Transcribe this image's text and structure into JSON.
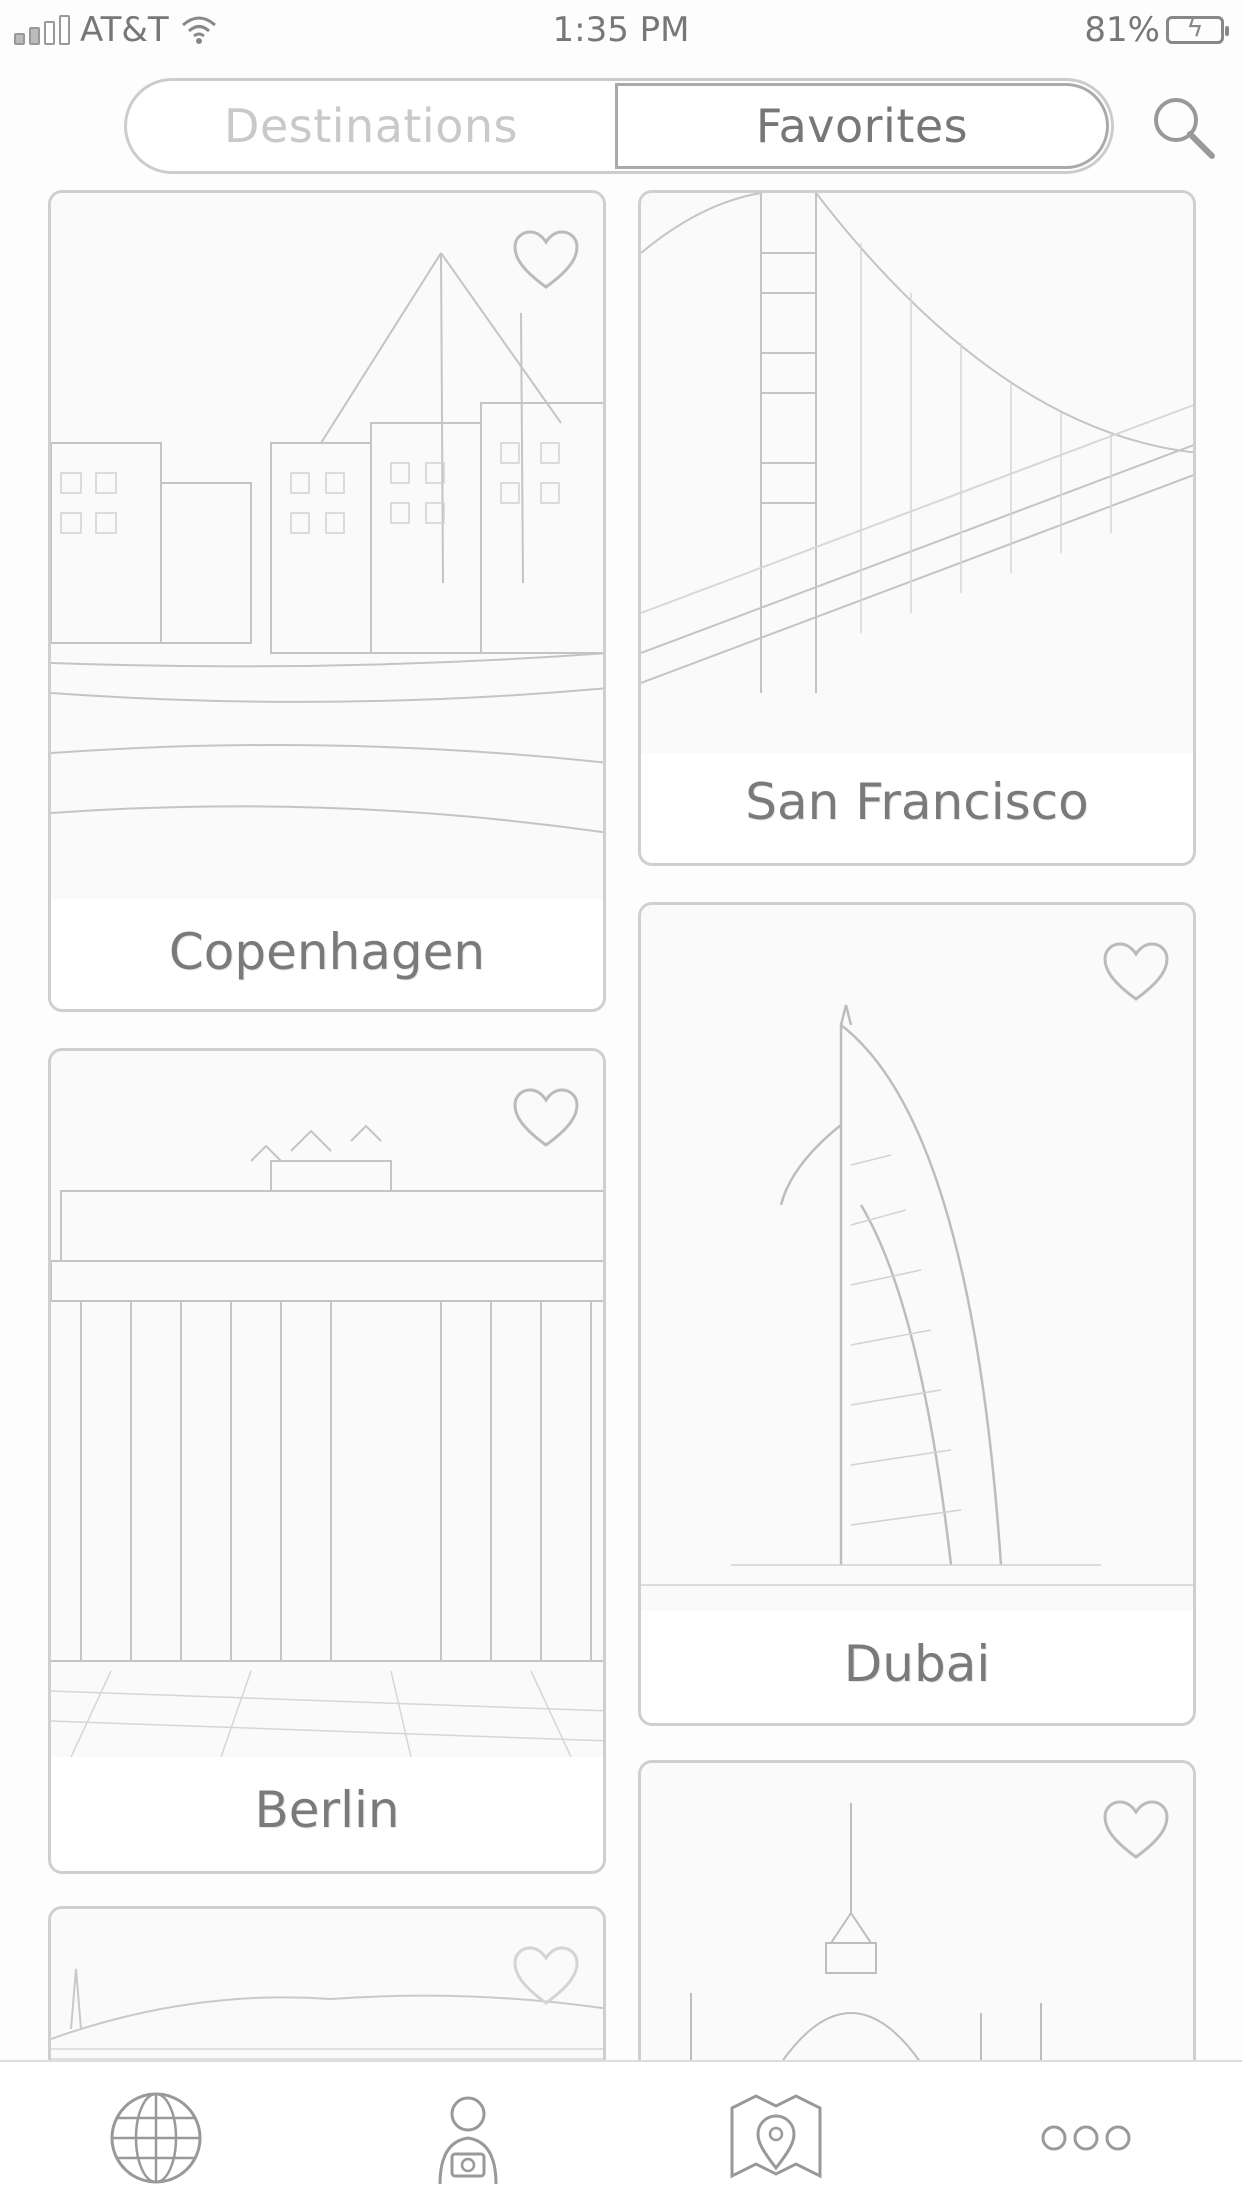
{
  "status_bar": {
    "carrier": "AT&T",
    "time": "1:35 PM",
    "battery_percent": "81%"
  },
  "segmented_control": {
    "tabs": [
      {
        "label": "Destinations",
        "selected": false
      },
      {
        "label": "Favorites",
        "selected": true
      }
    ]
  },
  "search": {
    "icon": "search-icon"
  },
  "cards": [
    {
      "city": "Copenhagen",
      "favorite_icon": "heart-outline-icon"
    },
    {
      "city": "San Francisco"
    },
    {
      "city": "Dubai",
      "favorite_icon": "heart-outline-icon"
    },
    {
      "city": "Berlin",
      "favorite_icon": "heart-outline-icon"
    },
    {
      "city": "",
      "favorite_icon": "heart-outline-icon"
    },
    {
      "city": "",
      "favorite_icon": "heart-outline-icon"
    }
  ],
  "tab_bar": {
    "items": [
      {
        "icon": "globe-icon"
      },
      {
        "icon": "traveler-camera-icon"
      },
      {
        "icon": "map-pin-icon"
      },
      {
        "icon": "more-dots-icon"
      }
    ]
  }
}
